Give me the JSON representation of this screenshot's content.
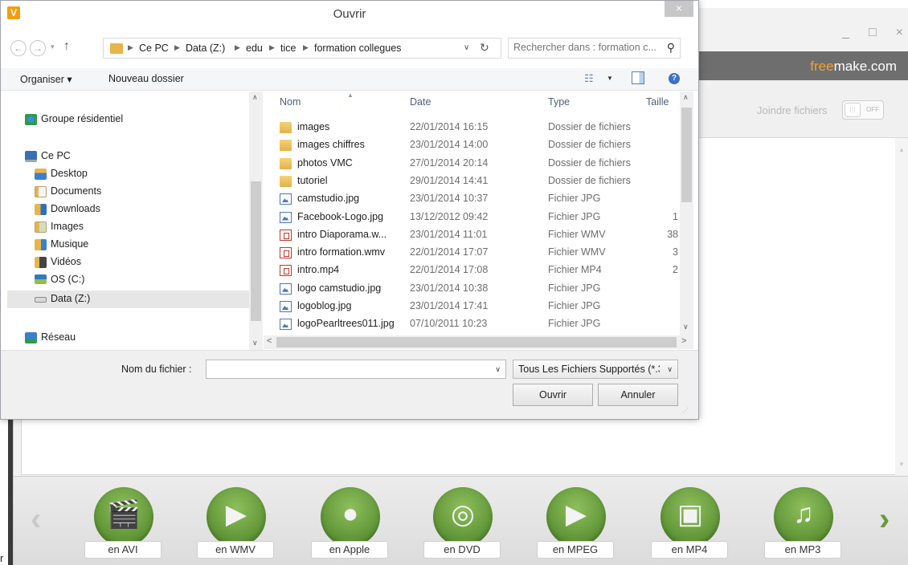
{
  "dialog": {
    "title": "Ouvrir",
    "close_glyph": "×"
  },
  "address": {
    "breadcrumbs": [
      "Ce PC",
      "Data (Z:)",
      "edu",
      "tice",
      "formation collegues"
    ],
    "search_placeholder": "Rechercher dans : formation c..."
  },
  "commandbar": {
    "organize_label": "Organiser ▾",
    "new_folder_label": "Nouveau dossier"
  },
  "tree": {
    "items": [
      {
        "label": "Groupe résidentiel",
        "icon": "homegroup-icon"
      },
      {
        "label": "Ce PC",
        "icon": "computer-icon"
      },
      {
        "label": "Desktop",
        "icon": "desktop-folder-icon"
      },
      {
        "label": "Documents",
        "icon": "documents-folder-icon"
      },
      {
        "label": "Downloads",
        "icon": "downloads-folder-icon"
      },
      {
        "label": "Images",
        "icon": "images-folder-icon"
      },
      {
        "label": "Musique",
        "icon": "music-folder-icon"
      },
      {
        "label": "Vidéos",
        "icon": "videos-folder-icon"
      },
      {
        "label": "OS (C:)",
        "icon": "os-drive-icon"
      },
      {
        "label": "Data (Z:)",
        "icon": "network-drive-icon",
        "selected": true
      },
      {
        "label": "Réseau",
        "icon": "network-icon"
      }
    ]
  },
  "files": {
    "columns": [
      "Nom",
      "Date",
      "Type",
      "Taille"
    ],
    "rows": [
      {
        "name": "images",
        "date": "22/01/2014 16:15",
        "type": "Dossier de fichiers",
        "size": "",
        "kind": "folder"
      },
      {
        "name": "images chiffres",
        "date": "23/01/2014 14:00",
        "type": "Dossier de fichiers",
        "size": "",
        "kind": "folder"
      },
      {
        "name": "photos VMC",
        "date": "27/01/2014 20:14",
        "type": "Dossier de fichiers",
        "size": "",
        "kind": "folder"
      },
      {
        "name": "tutoriel",
        "date": "29/01/2014 14:41",
        "type": "Dossier de fichiers",
        "size": "",
        "kind": "folder"
      },
      {
        "name": "camstudio.jpg",
        "date": "23/01/2014 10:37",
        "type": "Fichier JPG",
        "size": "",
        "kind": "jpg"
      },
      {
        "name": "Facebook-Logo.jpg",
        "date": "13/12/2012 09:42",
        "type": "Fichier JPG",
        "size": "1",
        "kind": "jpg"
      },
      {
        "name": "intro Diaporama.w...",
        "date": "23/01/2014 11:01",
        "type": "Fichier WMV",
        "size": "38",
        "kind": "wmv"
      },
      {
        "name": "intro formation.wmv",
        "date": "22/01/2014 17:07",
        "type": "Fichier WMV",
        "size": "3",
        "kind": "wmv"
      },
      {
        "name": "intro.mp4",
        "date": "22/01/2014 17:08",
        "type": "Fichier MP4",
        "size": "2",
        "kind": "wmv"
      },
      {
        "name": "logo camstudio.jpg",
        "date": "23/01/2014 10:38",
        "type": "Fichier JPG",
        "size": "",
        "kind": "jpg"
      },
      {
        "name": "logoblog.jpg",
        "date": "23/01/2014 17:41",
        "type": "Fichier JPG",
        "size": "",
        "kind": "jpg"
      },
      {
        "name": "logoPearltrees011.jpg",
        "date": "07/10/2011 10:23",
        "type": "Fichier JPG",
        "size": "",
        "kind": "jpg"
      }
    ]
  },
  "bottom": {
    "filename_label": "Nom du fichier :",
    "filename_value": "",
    "filter_value": "Tous Les Fichiers Supportés (*.3",
    "open_label": "Ouvrir",
    "cancel_label": "Annuler"
  },
  "app": {
    "brand_accent": "free",
    "brand_rest": "make.com",
    "join_label": "Joindre fichiers",
    "toggle_state": "OFF",
    "window_controls": [
      "_",
      "□",
      "×"
    ],
    "stray_text": "r",
    "converters": [
      "en AVI",
      "en WMV",
      "en Apple",
      "en DVD",
      "en MPEG",
      "en MP4",
      "en MP3"
    ],
    "colors": {
      "converter_green": "#5c9234",
      "brand_bar": "#6e6e6e",
      "brand_accent": "#f0a13a",
      "selection": "#e6e6e6"
    }
  }
}
